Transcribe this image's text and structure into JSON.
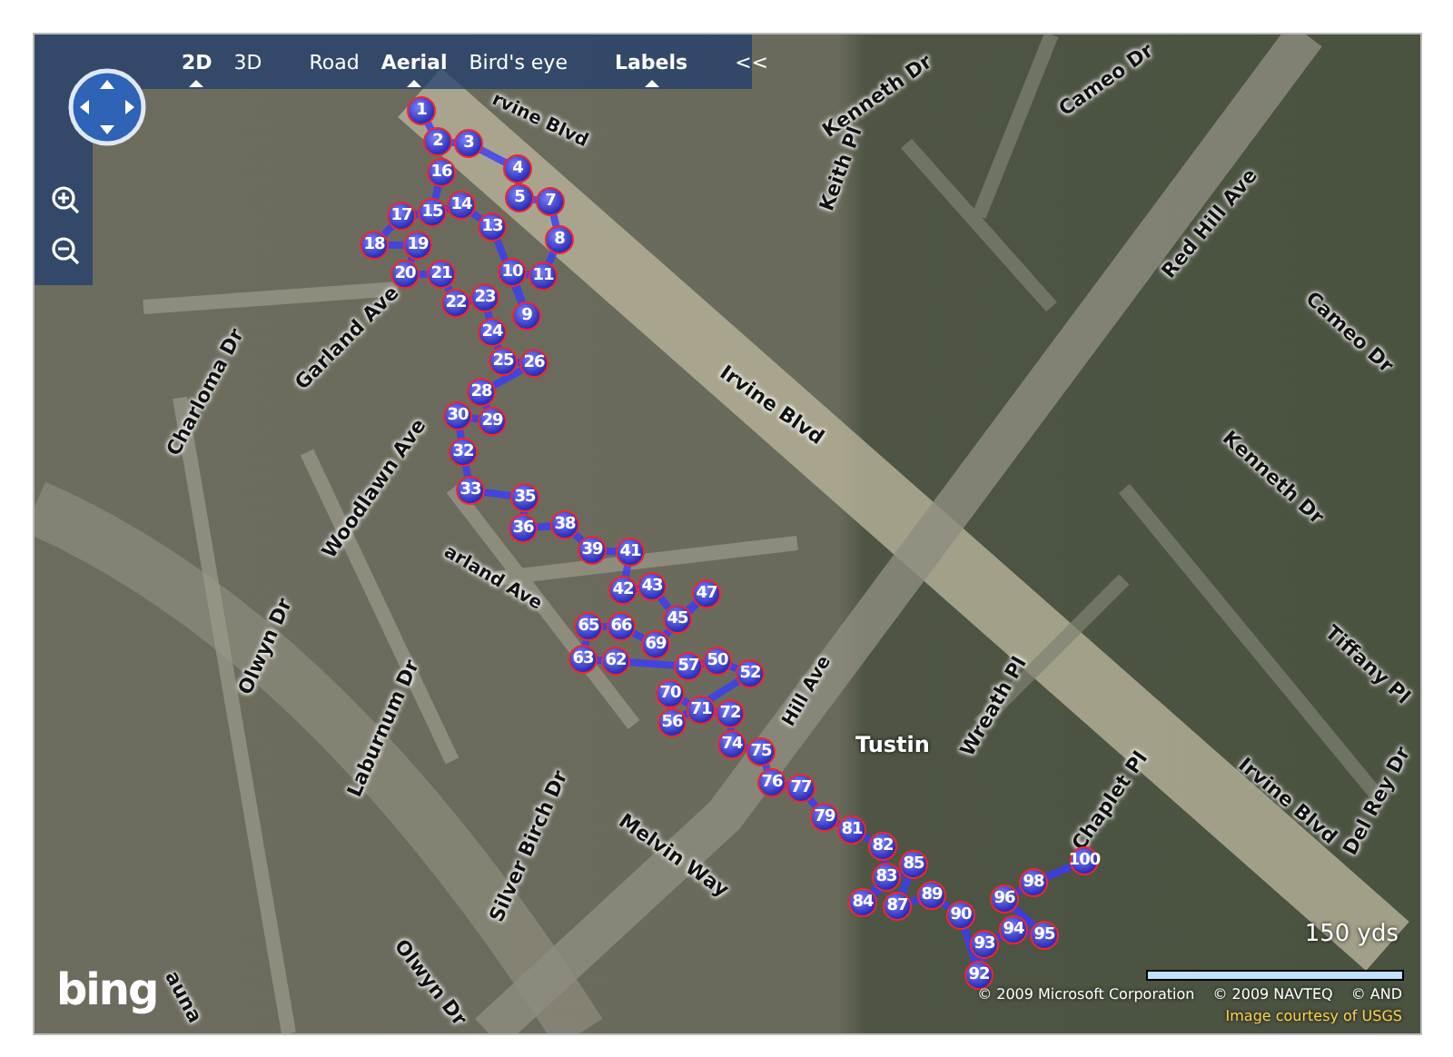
{
  "toolbar": {
    "views": [
      {
        "label": "2D",
        "selected": true
      },
      {
        "label": "3D",
        "selected": false
      }
    ],
    "styles": [
      {
        "label": "Road",
        "selected": false
      },
      {
        "label": "Aerial",
        "selected": true
      },
      {
        "label": "Bird's eye",
        "selected": false
      }
    ],
    "labels": {
      "label": "Labels",
      "on": true
    },
    "collapse": "<<"
  },
  "street_labels": [
    {
      "text": "rvine Blvd"
    },
    {
      "text": "Kenneth Dr"
    },
    {
      "text": "Cameo Dr"
    },
    {
      "text": "Keith Pl"
    },
    {
      "text": "Red Hill Ave"
    },
    {
      "text": "Cameo Dr"
    },
    {
      "text": "Kenneth Dr"
    },
    {
      "text": "Tiffany Pl"
    },
    {
      "text": "Irvine Blvd"
    },
    {
      "text": "Irvine Blvd"
    },
    {
      "text": "Del Rey Dr"
    },
    {
      "text": "Chaplet Pl"
    },
    {
      "text": "Wreath Pl"
    },
    {
      "text": "Hill Ave"
    },
    {
      "text": "Charloma Dr"
    },
    {
      "text": "Garland Ave"
    },
    {
      "text": "Woodlawn Ave"
    },
    {
      "text": "arland Ave"
    },
    {
      "text": "Olwyn Dr"
    },
    {
      "text": "Laburnum Dr"
    },
    {
      "text": "Silver Birch Dr"
    },
    {
      "text": "Melvin Way"
    },
    {
      "text": "Olwyn Dr"
    },
    {
      "text": "auna"
    }
  ],
  "place_label": "Tustin",
  "pins": [
    {
      "label": "1"
    },
    {
      "label": "2"
    },
    {
      "label": "3"
    },
    {
      "label": "4"
    },
    {
      "label": "5"
    },
    {
      "label": "7"
    },
    {
      "label": "8"
    },
    {
      "label": "9"
    },
    {
      "label": "10"
    },
    {
      "label": "11"
    },
    {
      "label": "13"
    },
    {
      "label": "14"
    },
    {
      "label": "15"
    },
    {
      "label": "16"
    },
    {
      "label": "17"
    },
    {
      "label": "18"
    },
    {
      "label": "19"
    },
    {
      "label": "20"
    },
    {
      "label": "21"
    },
    {
      "label": "22"
    },
    {
      "label": "23"
    },
    {
      "label": "24"
    },
    {
      "label": "25"
    },
    {
      "label": "26"
    },
    {
      "label": "28"
    },
    {
      "label": "29"
    },
    {
      "label": "30"
    },
    {
      "label": "32"
    },
    {
      "label": "33"
    },
    {
      "label": "35"
    },
    {
      "label": "36"
    },
    {
      "label": "38"
    },
    {
      "label": "39"
    },
    {
      "label": "41"
    },
    {
      "label": "42"
    },
    {
      "label": "43"
    },
    {
      "label": "45"
    },
    {
      "label": "47"
    },
    {
      "label": "50"
    },
    {
      "label": "52"
    },
    {
      "label": "56"
    },
    {
      "label": "57"
    },
    {
      "label": "63"
    },
    {
      "label": "62"
    },
    {
      "label": "65"
    },
    {
      "label": "66"
    },
    {
      "label": "69"
    },
    {
      "label": "70"
    },
    {
      "label": "71"
    },
    {
      "label": "72"
    },
    {
      "label": "74"
    },
    {
      "label": "75"
    },
    {
      "label": "76"
    },
    {
      "label": "77"
    },
    {
      "label": "79"
    },
    {
      "label": "81"
    },
    {
      "label": "82"
    },
    {
      "label": "83"
    },
    {
      "label": "84"
    },
    {
      "label": "85"
    },
    {
      "label": "87"
    },
    {
      "label": "89"
    },
    {
      "label": "90"
    },
    {
      "label": "92"
    },
    {
      "label": "93"
    },
    {
      "label": "94"
    },
    {
      "label": "95"
    },
    {
      "label": "96"
    },
    {
      "label": "98"
    },
    {
      "label": "100"
    }
  ],
  "scale": {
    "label": "150 yds"
  },
  "logo": "bing",
  "copyright": [
    "© 2009 Microsoft Corporation",
    "© 2009 NAVTEQ",
    "© AND"
  ],
  "image_credit": "Image courtesy of USGS"
}
